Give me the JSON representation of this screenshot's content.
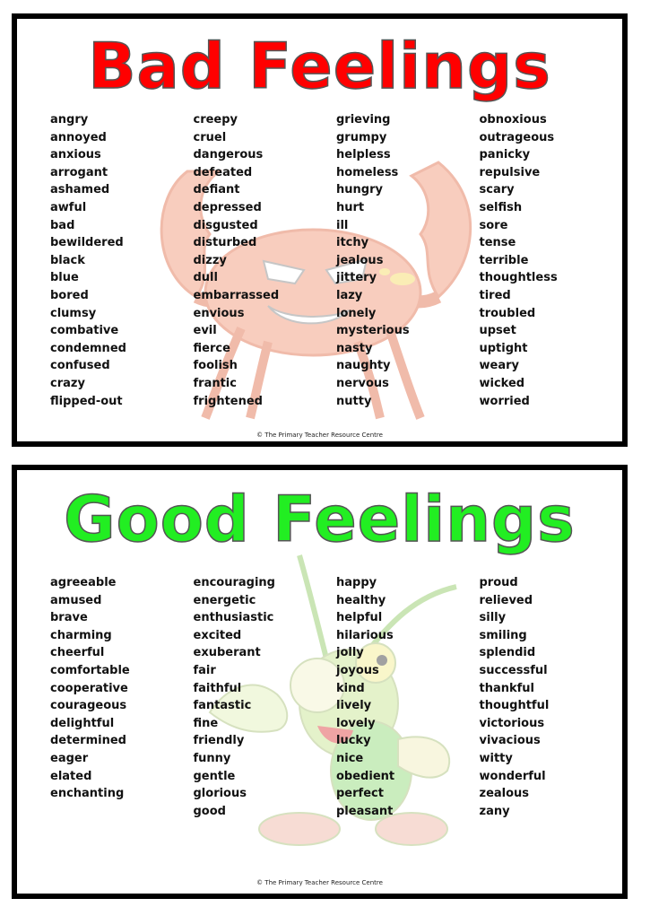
{
  "bad": {
    "title": "Bad Feelings",
    "title_color": "#ff0000",
    "illustration": "angry-crab",
    "columns": [
      [
        "angry",
        "annoyed",
        "anxious",
        "arrogant",
        "ashamed",
        "awful",
        "bad",
        "bewildered",
        "black",
        "blue",
        "bored",
        "clumsy",
        "combative",
        "condemned",
        "confused",
        "crazy",
        "flipped-out"
      ],
      [
        "creepy",
        "cruel",
        "dangerous",
        "defeated",
        "defiant",
        "depressed",
        "disgusted",
        "disturbed",
        "dizzy",
        "dull",
        "embarrassed",
        "envious",
        "evil",
        "fierce",
        "foolish",
        "frantic",
        "frightened"
      ],
      [
        "grieving",
        "grumpy",
        "helpless",
        "homeless",
        "hungry",
        "hurt",
        "ill",
        "itchy",
        "jealous",
        "jittery",
        "lazy",
        "lonely",
        "mysterious",
        "nasty",
        "naughty",
        "nervous",
        "nutty"
      ],
      [
        "obnoxious",
        "outrageous",
        "panicky",
        "repulsive",
        "scary",
        "selfish",
        "sore",
        "tense",
        "terrible",
        "thoughtless",
        "tired",
        "troubled",
        "upset",
        "uptight",
        "weary",
        "wicked",
        "worried"
      ]
    ],
    "footer": "© The Primary Teacher Resource Centre"
  },
  "good": {
    "title": "Good Feelings",
    "title_color": "#22ee22",
    "illustration": "happy-grasshopper",
    "columns": [
      [
        "agreeable",
        "amused",
        "brave",
        "charming",
        "cheerful",
        "comfortable",
        "cooperative",
        "courageous",
        "delightful",
        "determined",
        "eager",
        "elated",
        "enchanting"
      ],
      [
        "encouraging",
        "energetic",
        "enthusiastic",
        "excited",
        "exuberant",
        "fair",
        "faithful",
        "fantastic",
        "fine",
        "friendly",
        "funny",
        "gentle",
        "glorious",
        "good"
      ],
      [
        "happy",
        "healthy",
        "helpful",
        "hilarious",
        "jolly",
        "joyous",
        "kind",
        "lively",
        "lovely",
        "lucky",
        "nice",
        "obedient",
        "perfect",
        "pleasant"
      ],
      [
        "proud",
        "relieved",
        "silly",
        "smiling",
        "splendid",
        "successful",
        "thankful",
        "thoughtful",
        "victorious",
        "vivacious",
        "witty",
        "wonderful",
        "zealous",
        "zany"
      ]
    ],
    "footer": "© The Primary Teacher Resource Centre"
  }
}
